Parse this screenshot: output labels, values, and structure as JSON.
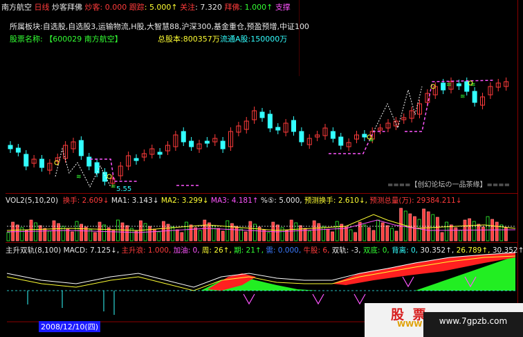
{
  "header": {
    "stock_short": "南方航空",
    "period": "日线",
    "indicator_name": "炒客拜佛",
    "label_chaoke": "炒客",
    "val_chaoke": "0.000",
    "label_genzong": "跟踪",
    "val_genzong": "5.000↑",
    "label_guanzhu": "关注",
    "val_guanzhu": "7.320",
    "label_baifo": "拜佛",
    "val_baifo": "1.000↑",
    "label_zhicheng": "支撑"
  },
  "info": {
    "sector_line": "所属板块:自选股,自选股3,运输物流,H股,大智慧88,沪深300,基金重仓,预盈预增,中证100",
    "name_label": "股票名称:",
    "name_value": "【600029 南方航空】",
    "total_shares": "总股本:800357万",
    "float_shares": "流通A股:150000万"
  },
  "main_chart": {
    "low_label": "5.55",
    "forum_text": "====【创幻论坛の一品茶缘】===="
  },
  "vol_panel": {
    "name": "VOL2(5,10,20)",
    "huanshou_label": "换手",
    "huanshou_val": "2.609↓",
    "ma1_label": "MA1:",
    "ma1_val": "3.143↓",
    "ma2_label": "MA2:",
    "ma2_val": "3.299↓",
    "ma3_label": "MA3:",
    "ma3_val": "4.181↑",
    "pct_label": "%⑤:",
    "pct_val": "5.000,",
    "yc_huanshou_label": "预测换手:",
    "yc_huanshou_val": "2.610↓,",
    "yc_zongliang_label": "预测总量(万):",
    "yc_zongliang_val": "29384.211↓"
  },
  "macd_panel": {
    "name": "主升双轨(8,100)",
    "macd_label": "MACD:",
    "macd_val": "7.125↓,",
    "zsl_label": "主升浪:",
    "zsl_val": "1.000,",
    "jiayou_label": "加油:",
    "jiayou_val": "0,",
    "zhou_label": "周:",
    "zhou_val": "26↑,",
    "qi_label": "期:",
    "qi_val": "21↑,",
    "xu_label": "需:",
    "xu_val": "0.000,",
    "niugu_label": "牛股:",
    "niugu_val": "6,",
    "shuanggui_label": "双轨:",
    "shuanggui_val": "-3,",
    "shuangdi_label": "双底:",
    "shuangdi_val": "0,",
    "beili_label": "背离:",
    "beili_val": "0,",
    "v1": "30.352↑,",
    "v2": "26.789↑,",
    "v3": "30.352↑"
  },
  "footer": {
    "date_tag": "2008/12/10(四)"
  },
  "watermark": {
    "cn": "股 票",
    "site": "www.7gpzb.com",
    "sub": "WWW"
  },
  "colors": {
    "up": "#ff3b3b",
    "down": "#33ffff",
    "text_yellow": "#ffff33",
    "grid": "#8b0000"
  }
}
